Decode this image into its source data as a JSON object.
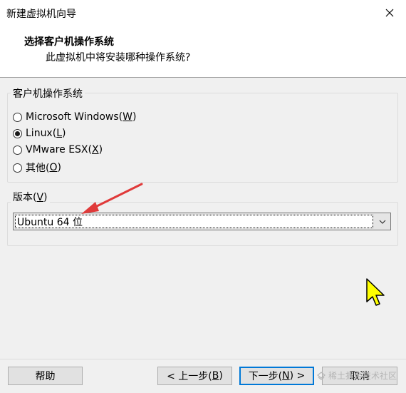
{
  "window": {
    "title": "新建虚拟机向导"
  },
  "header": {
    "title": "选择客户机操作系统",
    "subtitle": "此虚拟机中将安装哪种操作系统?"
  },
  "os_group": {
    "label": "客户机操作系统",
    "options": [
      {
        "text": "Microsoft Windows(",
        "key": "W",
        "close": ")",
        "checked": false
      },
      {
        "text": "Linux(",
        "key": "L",
        "close": ")",
        "checked": true
      },
      {
        "text": "VMware ESX(",
        "key": "X",
        "close": ")",
        "checked": false
      },
      {
        "text": "其他(",
        "key": "O",
        "close": ")",
        "checked": false
      }
    ]
  },
  "version_group": {
    "label_text": "版本(",
    "label_key": "V",
    "label_close": ")",
    "selected": "Ubuntu 64 位"
  },
  "buttons": {
    "help": "帮助",
    "back_pre": "< 上一步(",
    "back_key": "B",
    "back_post": ")",
    "next_pre": "下一步(",
    "next_key": "N",
    "next_post": ") >",
    "cancel": "取消"
  },
  "watermark": "稀土掘金技术社区",
  "colors": {
    "annotation_arrow": "#e03a3a",
    "cursor": "#ffff00",
    "focus": "#0078d7"
  }
}
